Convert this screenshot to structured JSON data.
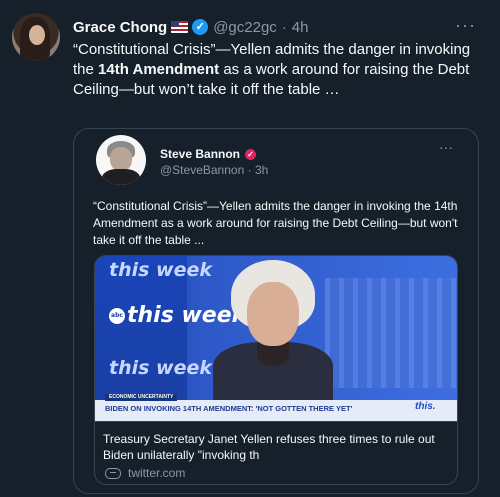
{
  "tweet": {
    "author_name": "Grace Chong",
    "author_handle": "@gc22gc",
    "time": "4h",
    "text_part1": "“Constitutional Crisis”—Yellen admits the danger in invoking the ",
    "text_bold": "14th Amendment",
    "text_part2": " as a work around for raising the Debt Ceiling—but won’t take it off the table …",
    "more": "···"
  },
  "quote": {
    "author_name": "Steve Bannon",
    "author_handle": "@SteveBannon",
    "time": "3h",
    "text": "“Constitutional Crisis”—Yellen admits the danger in invoking the 14th Amendment as a work around for raising the Debt Ceiling—but won't take it off the table ...",
    "more": "···",
    "media": {
      "logo_top": "this week",
      "logo_mid": "this week",
      "logo_abc": "abc",
      "logo_bottom": "this week",
      "chyron_tag": "ECONOMIC UNCERTAINTY",
      "chyron_text": "BIDEN ON INVOKING 14TH AMENDMENT: 'NOT GOTTEN THERE YET'",
      "chyron_logo": "this."
    },
    "card": {
      "title": "Treasury Secretary Janet Yellen refuses three times to rule out Biden unilaterally \"invoking th",
      "domain": "twitter.com"
    }
  },
  "colors": {
    "background": "#15202b",
    "verified": "#1d9bf0",
    "border": "#38444d",
    "muted": "#8b98a5"
  }
}
